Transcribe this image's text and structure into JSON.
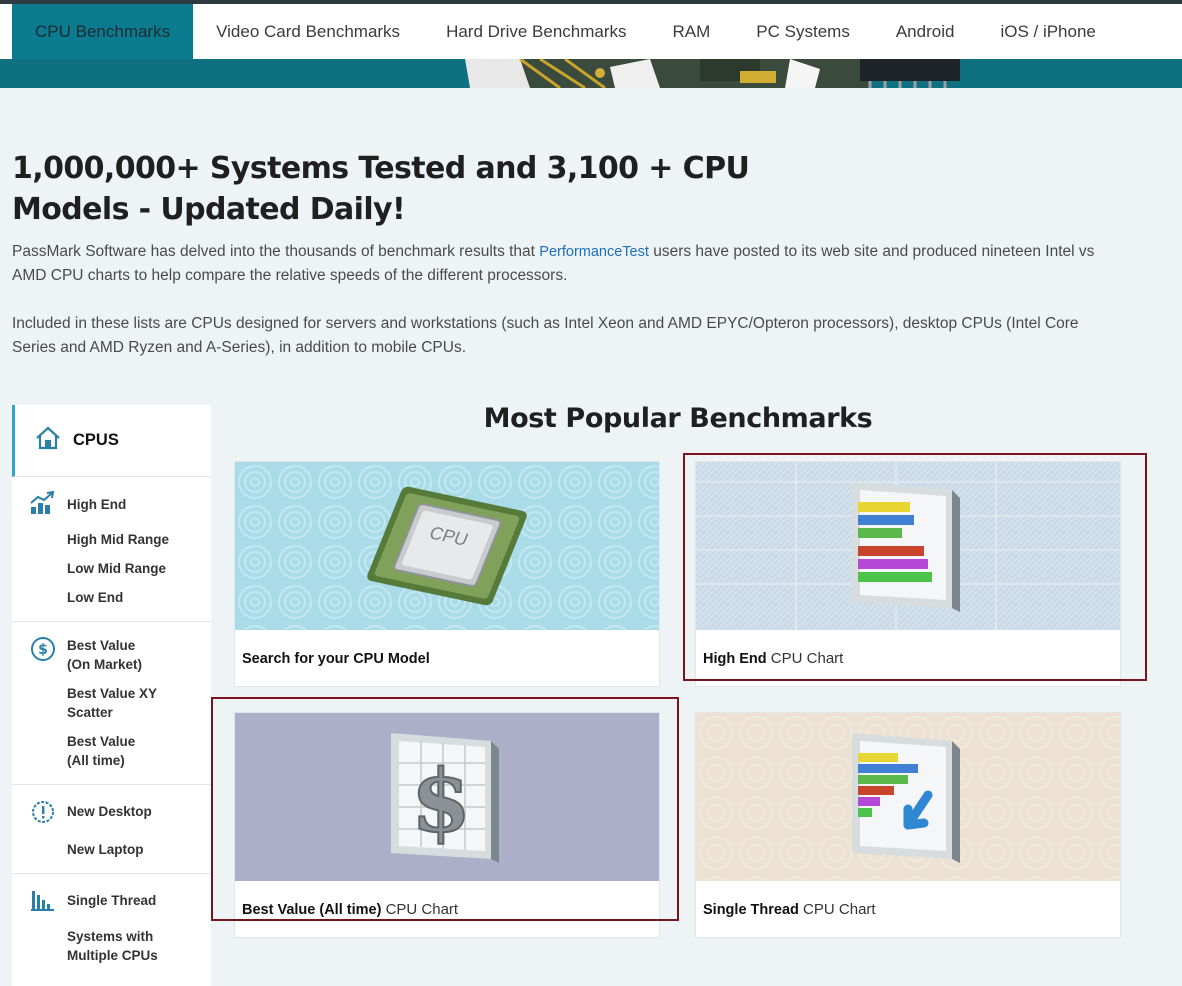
{
  "nav": {
    "items": [
      "CPU Benchmarks",
      "Video Card Benchmarks",
      "Hard Drive Benchmarks",
      "RAM",
      "PC Systems",
      "Android",
      "iOS / iPhone"
    ]
  },
  "headline": "1,000,000+ Systems Tested and 3,100 + CPU Models - Updated Daily!",
  "intro": {
    "p1_before": "PassMark Software has delved into the thousands of benchmark results that ",
    "p1_link": "PerformanceTest",
    "p1_after": " users have posted to its web site and produced nineteen Intel vs AMD CPU charts to help compare the relative speeds of the different processors.",
    "p2": "Included in these lists are CPUs designed for servers and workstations (such as Intel Xeon and AMD EPYC/Opteron processors), desktop CPUs (Intel Core Series and AMD Ryzen and A-Series), in addition to mobile CPUs."
  },
  "sidebar": {
    "title": "CPUS",
    "groups": [
      {
        "icon": "trend-chart-icon",
        "main": "High End",
        "subs": [
          "High Mid Range",
          "Low Mid Range",
          "Low End"
        ]
      },
      {
        "icon": "dollar-icon",
        "main": "Best Value\n(On Market)",
        "subs": [
          "Best Value XY\nScatter",
          "Best Value\n(All time)"
        ]
      },
      {
        "icon": "alert-icon",
        "main": "New Desktop",
        "subs": [
          "New Laptop"
        ]
      },
      {
        "icon": "bar-chart-icon",
        "main": "Single Thread",
        "subs": [
          "Systems with\nMultiple CPUs"
        ]
      }
    ]
  },
  "section_title": "Most Popular Benchmarks",
  "cards": [
    {
      "bold": "Search for your CPU Model",
      "rest": "",
      "chip_text": "CPU"
    },
    {
      "bold": "High End",
      "rest": " CPU Chart"
    },
    {
      "bold": "Best Value (All time)",
      "rest": " CPU Chart"
    },
    {
      "bold": "Single Thread",
      "rest": " CPU Chart"
    }
  ],
  "colors": {
    "nav_active": "#0b7b8f",
    "banner": "#0e7080",
    "highlight": "#7a1320",
    "link": "#1a6fc2"
  }
}
